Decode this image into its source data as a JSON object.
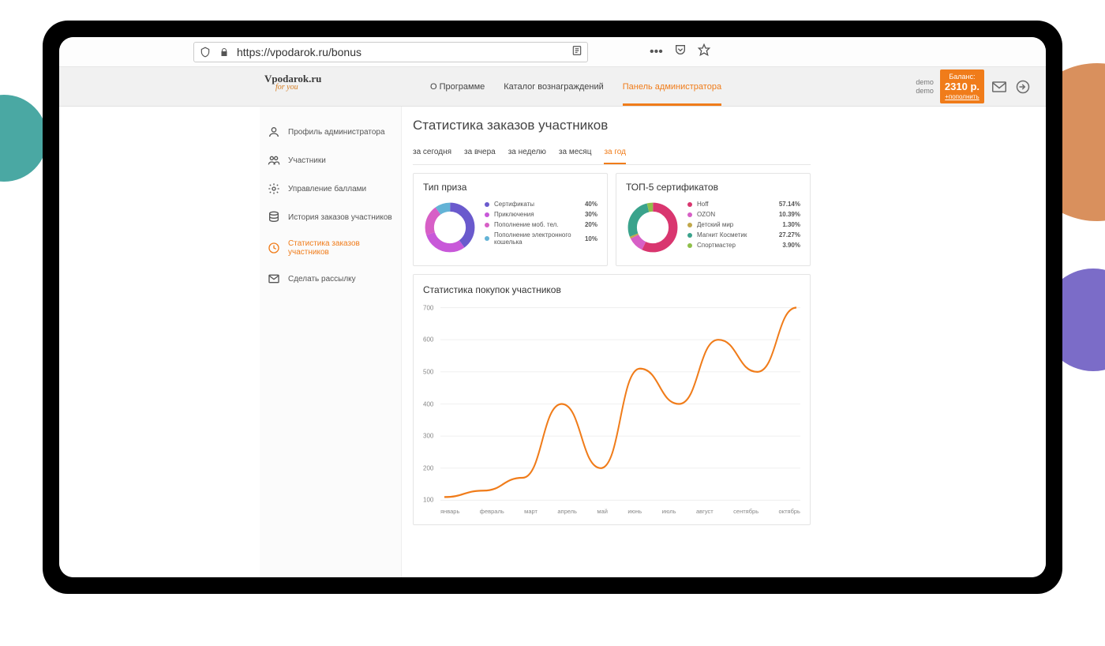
{
  "browser": {
    "url": "https://vpodarok.ru/bonus"
  },
  "header": {
    "nav": [
      {
        "label": "О Программе"
      },
      {
        "label": "Каталог вознаграждений"
      },
      {
        "label": "Панель администратора",
        "active": true
      }
    ],
    "user_line1": "demo",
    "user_line2": "demo",
    "balance_label": "Баланс:",
    "balance_amount": "2310 р.",
    "balance_topup": "+пополнить"
  },
  "sidebar": {
    "items": [
      {
        "label": "Профиль администратора",
        "icon": "user"
      },
      {
        "label": "Участники",
        "icon": "users"
      },
      {
        "label": "Управление баллами",
        "icon": "gear"
      },
      {
        "label": "История заказов участников",
        "icon": "db"
      },
      {
        "label": "Статистика заказов участников",
        "icon": "clock",
        "active": true
      },
      {
        "label": "Сделать рассылку",
        "icon": "mail"
      }
    ]
  },
  "page": {
    "title": "Статистика заказов участников",
    "tabs": [
      {
        "label": "за сегодня"
      },
      {
        "label": "за вчера"
      },
      {
        "label": "за неделю"
      },
      {
        "label": "за месяц"
      },
      {
        "label": "за год",
        "active": true
      }
    ]
  },
  "card_prize": {
    "title": "Тип приза",
    "items": [
      {
        "label": "Сертификаты",
        "value": "40%",
        "color": "#6a5acd"
      },
      {
        "label": "Приключения",
        "value": "30%",
        "color": "#c858d9"
      },
      {
        "label": "Пополнение моб. тел.",
        "value": "20%",
        "color": "#d75fc6"
      },
      {
        "label": "Пополнение электронного кошелька",
        "value": "10%",
        "color": "#63b3d6"
      }
    ]
  },
  "card_top5": {
    "title": "ТОП-5 сертификатов",
    "items": [
      {
        "label": "Hoff",
        "value": "57.14%",
        "color": "#d9366f"
      },
      {
        "label": "OZON",
        "value": "10.39%",
        "color": "#d75fc6"
      },
      {
        "label": "Детский мир",
        "value": "1.30%",
        "color": "#c1a84a"
      },
      {
        "label": "Магнит Косметик",
        "value": "27.27%",
        "color": "#3aa38c"
      },
      {
        "label": "Спортмастер",
        "value": "3.90%",
        "color": "#8fbf4a"
      }
    ]
  },
  "card_line": {
    "title": "Статистика покупок участников"
  },
  "chart_data": {
    "type": "line",
    "title": "Статистика покупок участников",
    "xlabel": "",
    "ylabel": "",
    "ylim": [
      100,
      700
    ],
    "categories": [
      "январь",
      "февраль",
      "март",
      "апрель",
      "май",
      "июнь",
      "июль",
      "август",
      "сентябрь",
      "октябрь"
    ],
    "values": [
      110,
      130,
      170,
      400,
      200,
      510,
      400,
      600,
      500,
      700
    ]
  }
}
